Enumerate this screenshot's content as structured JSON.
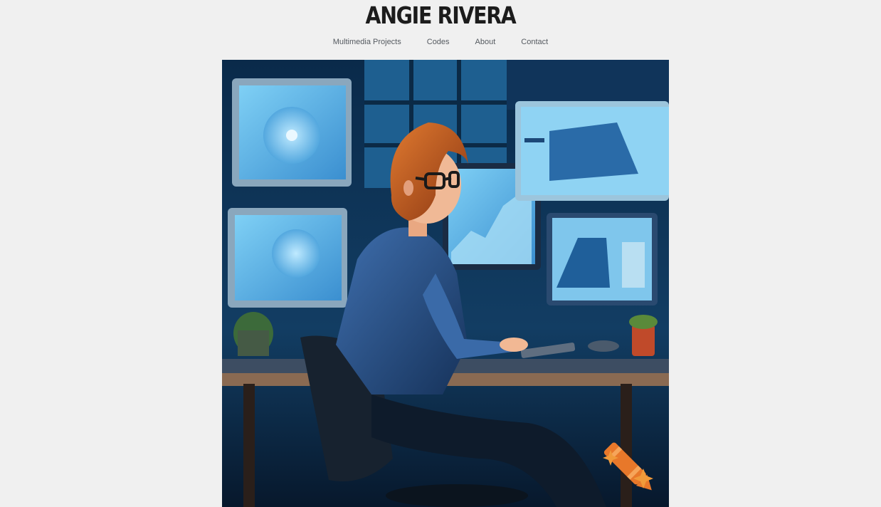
{
  "header": {
    "title": "ANGIE RIVERA"
  },
  "nav": {
    "items": [
      {
        "label": "Multimedia Projects"
      },
      {
        "label": "Codes"
      },
      {
        "label": "About"
      },
      {
        "label": "Contact"
      }
    ]
  },
  "hero": {
    "subject": "illustrated woman with orange bob and glasses working at a multi-monitor desk",
    "badge_icon": "crayon-sparkle-icon",
    "colors": {
      "background": "#0d2540",
      "screen": "#5bb8e8",
      "hair": "#c8581f",
      "crayon": "#e8782a"
    }
  }
}
